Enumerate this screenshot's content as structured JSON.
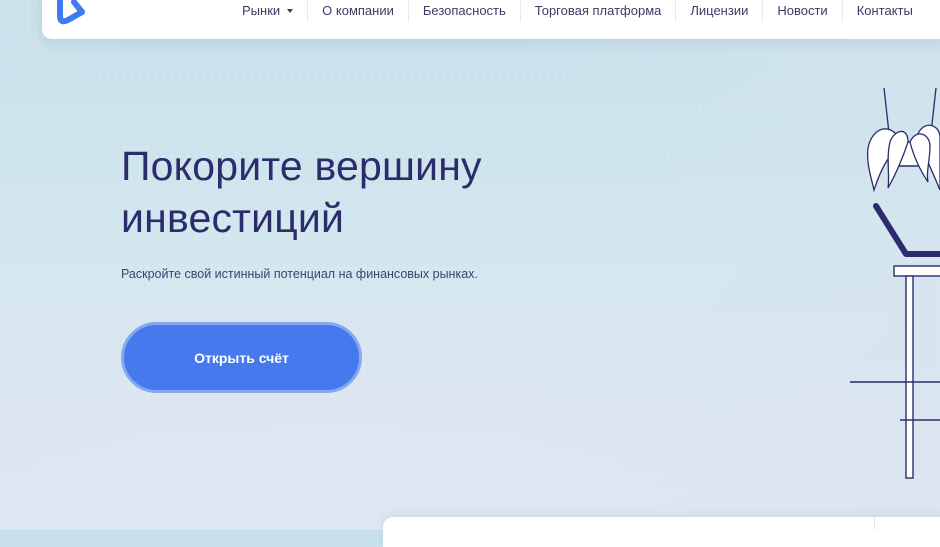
{
  "nav": {
    "items": [
      {
        "label": "Рынки",
        "dropdown": true
      },
      {
        "label": "О компании"
      },
      {
        "label": "Безопасность"
      },
      {
        "label": "Торговая платформа"
      },
      {
        "label": "Лицензии"
      },
      {
        "label": "Новости"
      },
      {
        "label": "Контакты"
      }
    ]
  },
  "hero": {
    "title_line1": "Покорите вершину",
    "title_line2": "инвестиций",
    "subtitle": "Раскройте свой истинный потенциал на финансовых рынках.",
    "cta_label": "Открыть счёт"
  },
  "colors": {
    "accent": "#4679ee",
    "heading": "#2c2c6c",
    "logo": "#3f7bf0"
  },
  "icons": {
    "logo": "brand-k-logo",
    "nav_dropdown": "caret-down-icon",
    "illustration": "plant-desk-illustration"
  }
}
